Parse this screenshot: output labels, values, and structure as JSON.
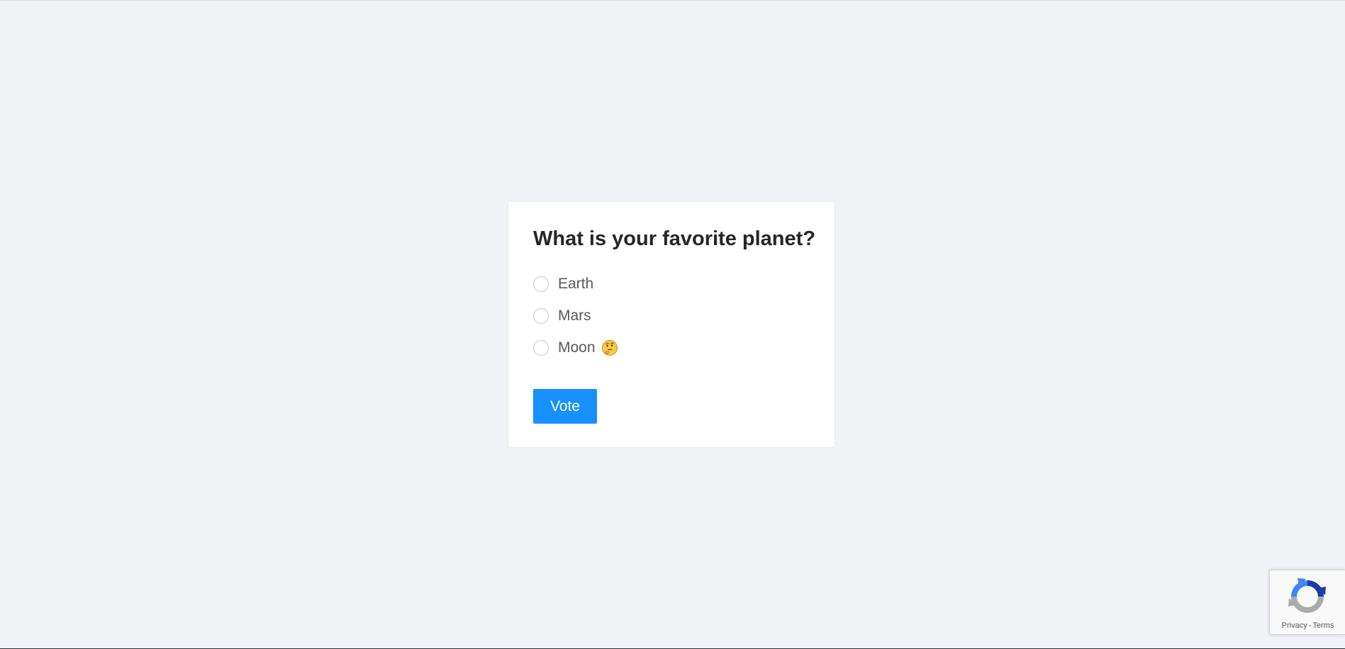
{
  "poll": {
    "question": "What is your favorite planet?",
    "options": [
      {
        "label": "Earth"
      },
      {
        "label": "Mars"
      },
      {
        "label": "Moon",
        "emoji": "thinking-face"
      }
    ],
    "vote_label": "Vote"
  },
  "recaptcha": {
    "privacy_label": "Privacy",
    "separator": "-",
    "terms_label": "Terms"
  },
  "colors": {
    "page_background": "#f0f2f5",
    "card_background": "#ffffff",
    "accent": "#1890ff",
    "heading_text": "#262626",
    "option_text": "#595959"
  }
}
